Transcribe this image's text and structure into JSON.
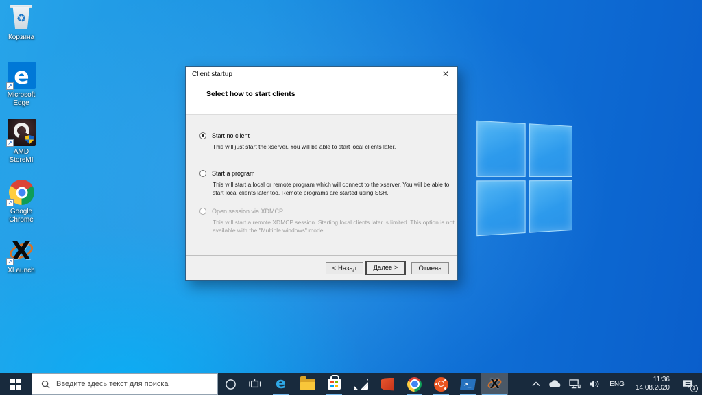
{
  "desktop": {
    "icons": [
      {
        "label": "Корзина"
      },
      {
        "label": "Microsoft Edge"
      },
      {
        "label": "AMD StoreMI"
      },
      {
        "label": "Google Chrome"
      },
      {
        "label": "XLaunch"
      }
    ],
    "glyphs": {
      "recycle": "♻",
      "edge_letter": "e",
      "xlaunch_letter": "X",
      "shortcut_arrow": "↗"
    }
  },
  "dialog": {
    "title": "Client startup",
    "close_glyph": "✕",
    "heading": "Select how to start clients",
    "options": [
      {
        "label": "Start no client",
        "desc": "This will just start the xserver. You will be able to start local clients later.",
        "selected": true,
        "disabled": false
      },
      {
        "label": "Start a program",
        "desc": "This will start a local or remote program which will connect to the xserver. You will be able to start local clients later too. Remote programs are started using SSH.",
        "selected": false,
        "disabled": false
      },
      {
        "label": "Open session via XDMCP",
        "desc": "This will start a remote XDMCP session. Starting local clients later is limited. This option is not available with the \"Multiple windows\" mode.",
        "selected": false,
        "disabled": true
      }
    ],
    "buttons": {
      "back": "< Назад",
      "next": "Далее >",
      "cancel": "Отмена"
    }
  },
  "taskbar": {
    "search_placeholder": "Введите здесь текст для поиска",
    "apps": [
      {
        "name": "edge",
        "running": true,
        "active": false
      },
      {
        "name": "file-explorer",
        "running": false,
        "active": false
      },
      {
        "name": "microsoft-store",
        "running": true,
        "active": false
      },
      {
        "name": "mail",
        "running": false,
        "active": false
      },
      {
        "name": "office",
        "running": false,
        "active": false
      },
      {
        "name": "chrome",
        "running": true,
        "active": false
      },
      {
        "name": "ubuntu",
        "running": true,
        "active": false
      },
      {
        "name": "powershell",
        "running": true,
        "active": false
      },
      {
        "name": "xlaunch",
        "running": true,
        "active": true
      }
    ],
    "powershell_glyph": ">_",
    "tray": {
      "language": "ENG",
      "time": "11:36",
      "date": "14.08.2020",
      "notification_count": "3"
    }
  },
  "colors": {
    "accent": "#0078d7",
    "taskbar": "#182a3d",
    "dialog_bg": "#f0f0f0",
    "desktop_left": "#27a4e9",
    "desktop_right": "#0a5ecb"
  }
}
